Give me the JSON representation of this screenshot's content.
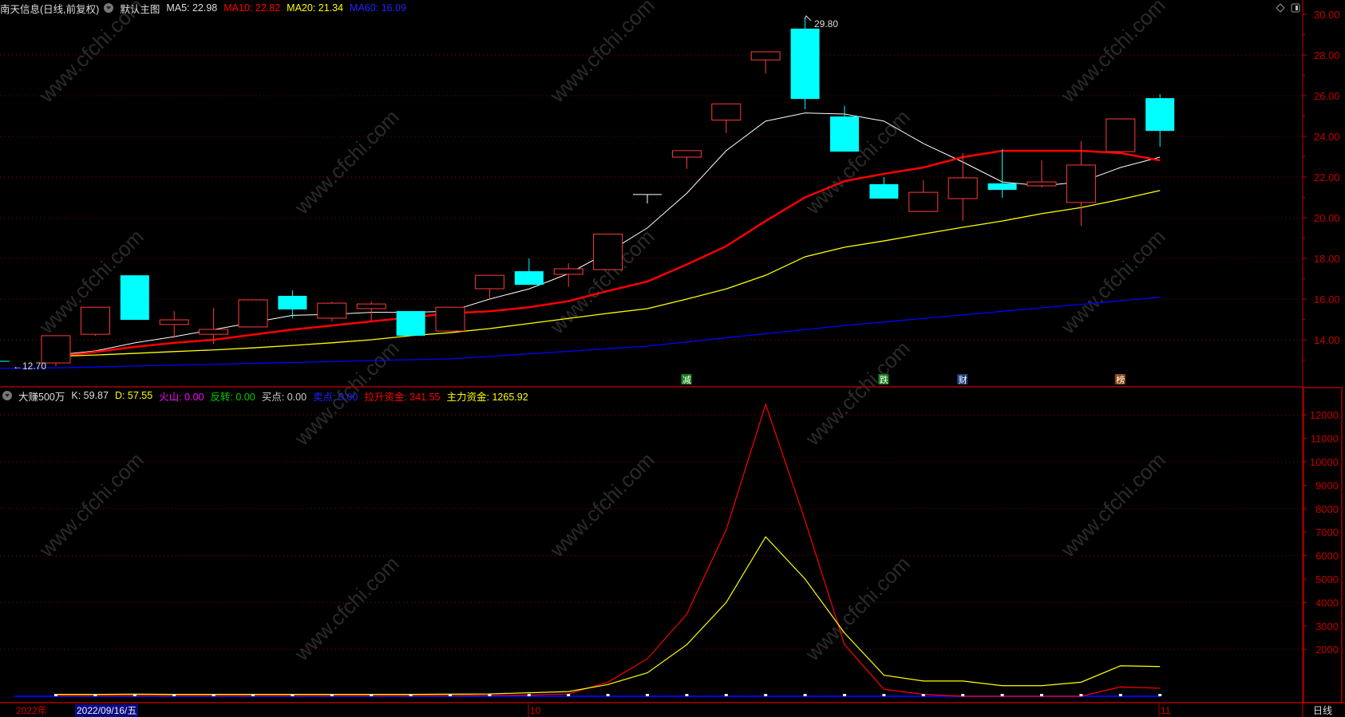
{
  "header": {
    "stock_title": "南天信息(日线,前复权)",
    "main_chart_label": "默认主图",
    "ma5": "MA5: 22.98",
    "ma10": "MA10: 22.82",
    "ma20": "MA20: 21.34",
    "ma60": "MA60: 16.09"
  },
  "indicator_header": {
    "name": "大赚500万",
    "k": "K: 59.87",
    "d": "D: 57.55",
    "volcano": "火山: 0.00",
    "reversal": "反转: 0.00",
    "buy": "买点: 0.00",
    "sell": "卖点: 0.00",
    "pull_funds": "拉升资金: 341.55",
    "main_funds": "主力资金: 1265.92"
  },
  "annotations": {
    "high_label": "29.80",
    "low_label": "←12.70",
    "markers": [
      {
        "text": "减",
        "index": 16,
        "color": "#1a7f1a"
      },
      {
        "text": "跌",
        "index": 21,
        "color": "#1a7f1a"
      },
      {
        "text": "财",
        "index": 23,
        "color": "#1b3f7a"
      },
      {
        "text": "榜",
        "index": 27,
        "color": "#8a4a10"
      }
    ]
  },
  "date_axis": {
    "year": "2022年",
    "cursor_date": "2022/09/16/五",
    "month_10": "10",
    "month_11": "11",
    "period": "日线"
  },
  "watermark": "www.cfchi.com",
  "colors": {
    "up": "#ff3b3b",
    "down": "#00ffff",
    "ma5": "#ffffff",
    "ma10": "#ff0000",
    "ma20": "#ffff00",
    "ma60": "#0000ff",
    "axis": "#c00000",
    "grid": "#8b0000"
  },
  "chart_data": [
    {
      "type": "candlestick",
      "title": "南天信息(日线,前复权)",
      "ylim": [
        12.5,
        30.2
      ],
      "y_ticks": [
        "30.00",
        "28.00",
        "26.00",
        "24.00",
        "22.00",
        "20.00",
        "18.00",
        "16.00",
        "14.00"
      ],
      "candles": [
        [
          12.86,
          14.2,
          12.7,
          14.2
        ],
        [
          14.27,
          15.6,
          14.2,
          15.6
        ],
        [
          17.17,
          17.17,
          14.98,
          14.98
        ],
        [
          14.75,
          15.41,
          14.08,
          14.98
        ],
        [
          14.27,
          15.57,
          13.8,
          14.51
        ],
        [
          14.63,
          15.96,
          14.63,
          15.96
        ],
        [
          16.16,
          16.43,
          15.06,
          15.49
        ],
        [
          15.06,
          15.88,
          14.9,
          15.8
        ],
        [
          15.53,
          15.88,
          14.9,
          15.76
        ],
        [
          15.41,
          15.41,
          14.2,
          14.2
        ],
        [
          14.43,
          15.6,
          14.43,
          15.6
        ],
        [
          16.51,
          17.17,
          16.0,
          17.17
        ],
        [
          17.37,
          18.0,
          16.7,
          16.7
        ],
        [
          17.22,
          17.76,
          16.6,
          17.49
        ],
        [
          17.45,
          19.2,
          17.45,
          19.2
        ],
        [
          21.14,
          21.14,
          20.7,
          21.14
        ],
        [
          22.98,
          23.3,
          22.4,
          23.3
        ],
        [
          24.8,
          25.6,
          24.16,
          25.6
        ],
        [
          27.76,
          28.16,
          27.1,
          28.16
        ],
        [
          29.3,
          29.8,
          25.33,
          25.84
        ],
        [
          24.98,
          25.5,
          23.25,
          23.25
        ],
        [
          21.65,
          22.0,
          20.94,
          20.94
        ],
        [
          20.31,
          21.84,
          20.31,
          21.25
        ],
        [
          20.94,
          23.18,
          19.84,
          21.96
        ],
        [
          21.69,
          23.37,
          20.98,
          21.37
        ],
        [
          21.57,
          22.82,
          21.49,
          21.76
        ],
        [
          20.75,
          23.76,
          19.6,
          22.59
        ],
        [
          23.25,
          24.86,
          23.25,
          24.86
        ],
        [
          25.88,
          26.08,
          23.49,
          24.27
        ]
      ],
      "series": [
        {
          "name": "MA5",
          "values": [
            13.25,
            13.45,
            13.85,
            14.15,
            14.5,
            14.85,
            15.2,
            15.25,
            15.35,
            15.35,
            15.4,
            16.0,
            16.5,
            17.25,
            18.3,
            19.5,
            21.2,
            23.3,
            24.75,
            25.15,
            25.1,
            24.75,
            23.65,
            22.74,
            21.76,
            21.57,
            21.76,
            22.47,
            22.98
          ]
        },
        {
          "name": "MA10",
          "values": [
            13.15,
            13.4,
            13.65,
            13.85,
            14.0,
            14.25,
            14.5,
            14.7,
            14.9,
            15.1,
            15.3,
            15.4,
            15.6,
            15.9,
            16.4,
            16.86,
            17.7,
            18.6,
            19.84,
            21.0,
            21.8,
            22.16,
            22.47,
            22.98,
            23.29,
            23.29,
            23.29,
            23.18,
            22.82
          ]
        },
        {
          "name": "MA20",
          "values": [
            13.18,
            13.25,
            13.33,
            13.42,
            13.5,
            13.6,
            13.72,
            13.85,
            14.0,
            14.2,
            14.35,
            14.55,
            14.8,
            15.05,
            15.3,
            15.53,
            16.0,
            16.5,
            17.17,
            18.08,
            18.55,
            18.86,
            19.2,
            19.53,
            19.84,
            20.2,
            20.5,
            20.9,
            21.34
          ]
        },
        {
          "name": "MA60",
          "values": [
            12.62,
            12.66,
            12.71,
            12.75,
            12.79,
            12.84,
            12.88,
            12.93,
            12.97,
            13.02,
            13.06,
            13.18,
            13.31,
            13.43,
            13.56,
            13.69,
            13.89,
            14.1,
            14.3,
            14.5,
            14.7,
            14.87,
            15.05,
            15.22,
            15.4,
            15.57,
            15.74,
            15.92,
            16.09
          ]
        }
      ]
    },
    {
      "type": "line",
      "title": "大赚500万",
      "ylim": [
        0,
        12800
      ],
      "y_ticks": [
        "12000",
        "11000",
        "10000",
        "9000",
        "8000",
        "7000",
        "6000",
        "5000",
        "4000",
        "3000",
        "2000"
      ],
      "series": [
        {
          "name": "拉升资金",
          "values": [
            30,
            30,
            30,
            30,
            30,
            30,
            30,
            30,
            30,
            30,
            30,
            40,
            50,
            100,
            600,
            1600,
            3500,
            7100,
            12450,
            7500,
            2200,
            300,
            80,
            0,
            0,
            0,
            0,
            400,
            341.55
          ]
        },
        {
          "name": "主力资金",
          "values": [
            80,
            80,
            90,
            80,
            80,
            80,
            80,
            80,
            80,
            80,
            90,
            100,
            150,
            200,
            500,
            1000,
            2200,
            4000,
            6800,
            5000,
            2700,
            900,
            650,
            650,
            450,
            450,
            600,
            1300,
            1265.92
          ]
        },
        {
          "name": "买点",
          "values": [
            0,
            0,
            0,
            0,
            0,
            0,
            0,
            0,
            0,
            0,
            0,
            0,
            0,
            0,
            0,
            0,
            0,
            0,
            0,
            0,
            0,
            0,
            0,
            0,
            0,
            0,
            0,
            0,
            0
          ]
        }
      ]
    }
  ]
}
